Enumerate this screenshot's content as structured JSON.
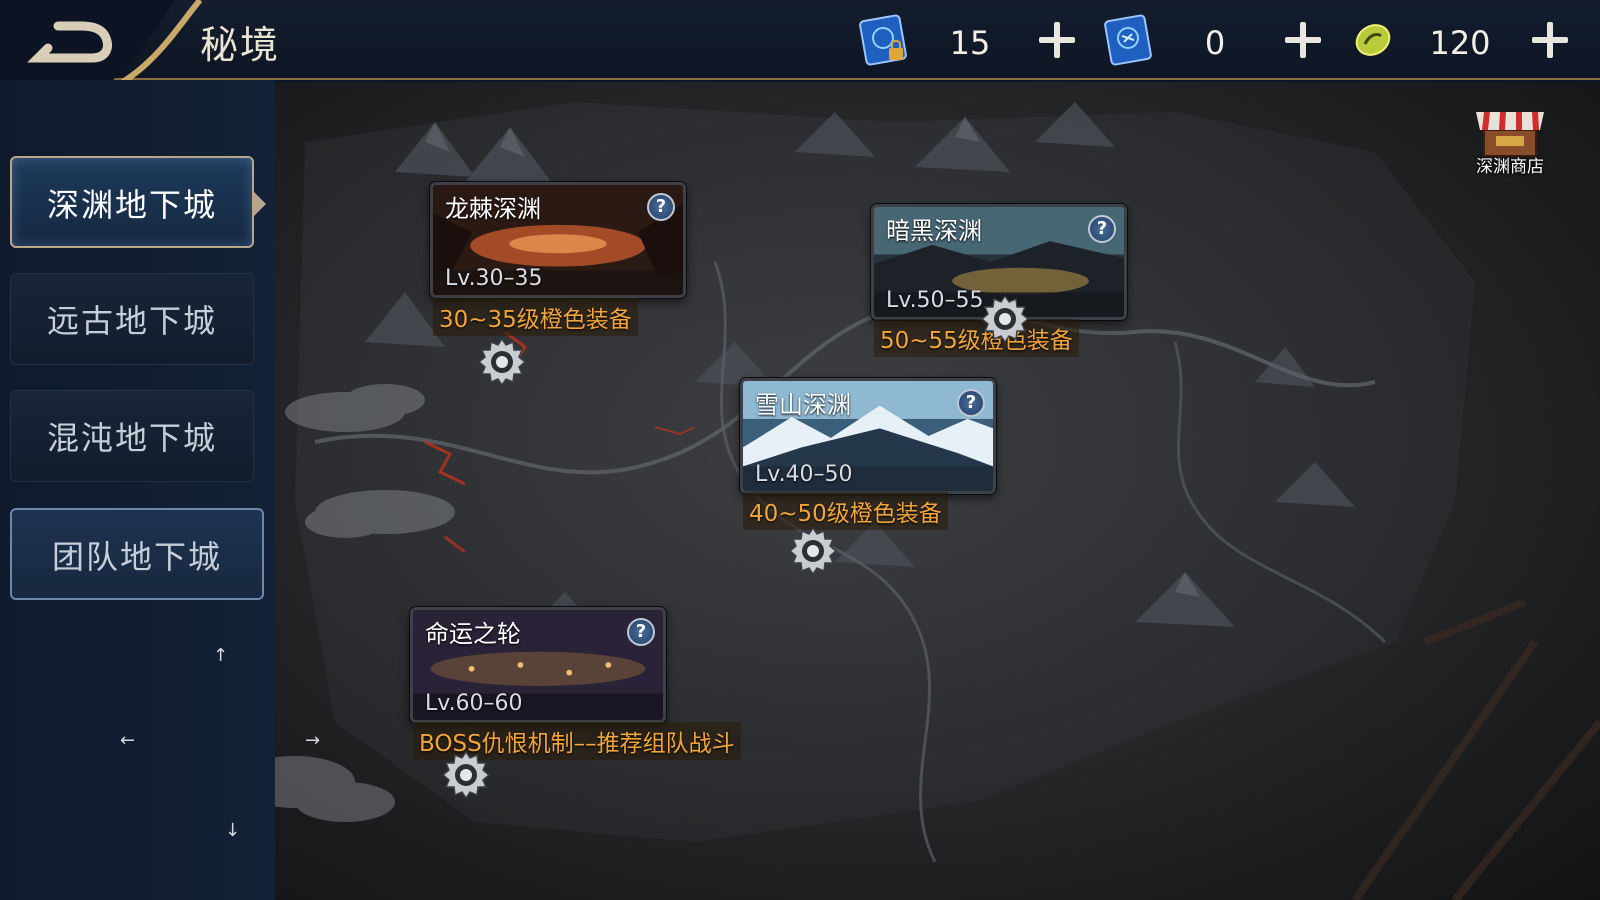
{
  "header": {
    "title": "秘境",
    "back_icon": "back-arrow-icon",
    "currencies": [
      {
        "icon": "locked-scroll-icon",
        "value": "15",
        "color": "#2b6fd1"
      },
      {
        "icon": "scroll-icon",
        "value": "0",
        "color": "#2b6fd1"
      },
      {
        "icon": "coin-icon",
        "value": "120",
        "color": "#c8d84a"
      }
    ]
  },
  "sidebar": {
    "tabs": [
      {
        "label": "深渊地下城",
        "active": true
      },
      {
        "label": "远古地下城",
        "active": false
      },
      {
        "label": "混沌地下城",
        "active": false
      },
      {
        "label": "团队地下城",
        "active": false
      }
    ],
    "arrows": {
      "up": "↑",
      "left": "←",
      "right": "→",
      "down": "↓"
    }
  },
  "shop": {
    "label": "深渊商店",
    "icon": "shop-stall-icon"
  },
  "dungeons": [
    {
      "name": "龙棘深渊",
      "level": "Lv.30–35",
      "reward": "30~35级橙色装备",
      "theme": "#c0552a"
    },
    {
      "name": "暗黑深渊",
      "level": "Lv.50–55",
      "reward": "50~55级橙色装备",
      "theme": "#4a7a8c"
    },
    {
      "name": "雪山深渊",
      "level": "Lv.40–50",
      "reward": "40~50级橙色装备",
      "theme": "#7fb6d6"
    },
    {
      "name": "命运之轮",
      "level": "Lv.60–60",
      "reward": "BOSS仇恨机制––推荐组队战斗",
      "theme": "#6a4a7a"
    }
  ],
  "colors": {
    "reward_text": "#f3a43a",
    "accent_gold": "#b9a68a"
  }
}
